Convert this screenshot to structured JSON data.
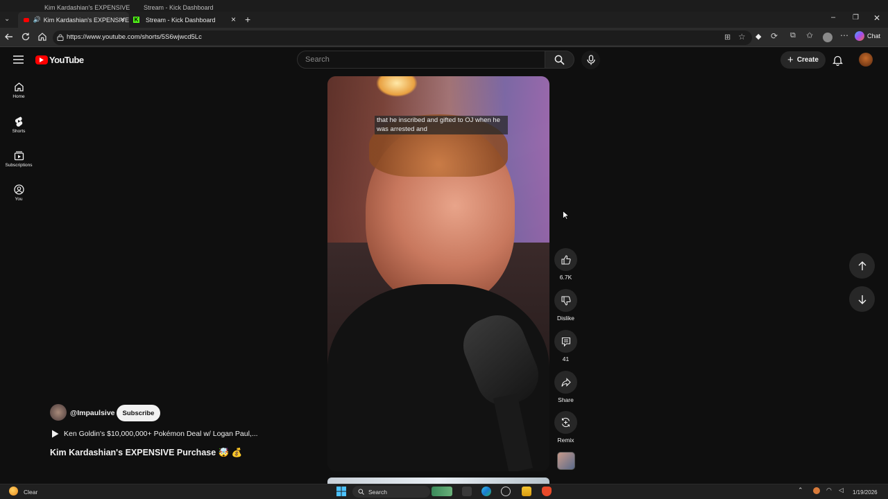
{
  "browser": {
    "tabs": [
      {
        "title": "Kim Kardashian's EXPENSIVE",
        "active": true
      },
      {
        "title": "Stream - Kick Dashboard",
        "active": false
      }
    ],
    "url": "https://www.youtube.com/shorts/5S6wjwcd5Lc",
    "chat_label": "Chat"
  },
  "youtube": {
    "logo_text": "YouTube",
    "search_placeholder": "Search",
    "create_label": "Create",
    "sidebar": [
      {
        "label": "Home",
        "icon": "home-icon"
      },
      {
        "label": "Shorts",
        "icon": "shorts-icon"
      },
      {
        "label": "Subscriptions",
        "icon": "subscriptions-icon"
      },
      {
        "label": "You",
        "icon": "you-icon"
      }
    ]
  },
  "short": {
    "caption": "that he inscribed and gifted to OJ when he was arrested and",
    "channel": "@Impaulsive",
    "subscribe_label": "Subscribe",
    "playlist": "Ken Goldin's $10,000,000+ Pokémon Deal w/ Logan Paul,...",
    "title": "Kim Kardashian's EXPENSIVE Purchase 🤯 💰",
    "actions": {
      "likes": "6.7K",
      "dislike": "Dislike",
      "comments": "41",
      "share": "Share",
      "remix": "Remix"
    }
  },
  "taskbar": {
    "weather": "Clear",
    "search": "Search",
    "date": "1/19/2026"
  },
  "colors": {
    "youtube_red": "#ff0000",
    "background": "#0f0f0f",
    "kick_green": "#53fc18"
  }
}
